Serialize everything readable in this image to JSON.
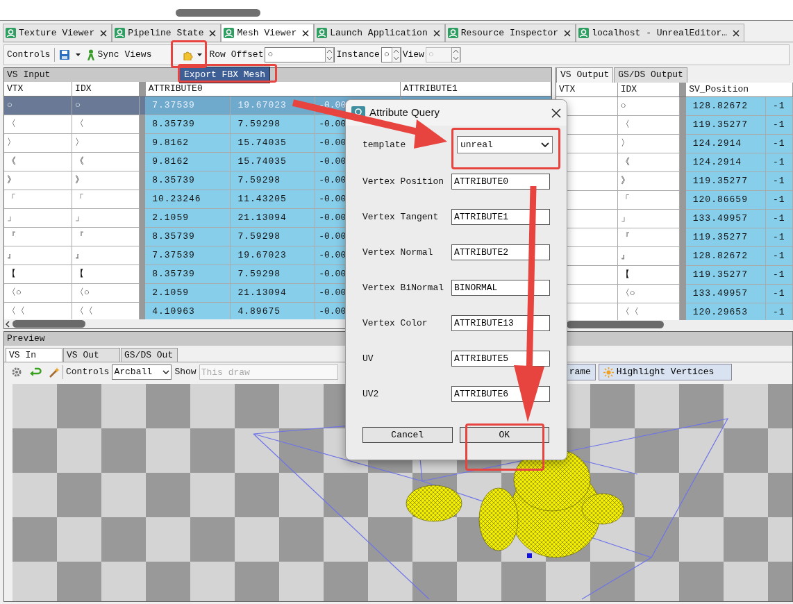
{
  "top_tabs": [
    {
      "label": "Texture Viewer",
      "selected": false
    },
    {
      "label": "Pipeline State",
      "selected": false
    },
    {
      "label": "Mesh Viewer",
      "selected": true
    },
    {
      "label": "Launch Application",
      "selected": false
    },
    {
      "label": "Resource Inspector",
      "selected": false
    },
    {
      "label": "localhost - UnrealEditor…",
      "selected": false
    }
  ],
  "toolbar": {
    "controls_label": "Controls",
    "sync_label": "Sync Views",
    "row_offset_label": "Row Offset",
    "row_offset_value": "○",
    "instance_label": "Instance",
    "instance_value": "○",
    "view_label": "View",
    "view_value": "○",
    "view_disabled": true
  },
  "export_menu": {
    "items": [
      {
        "label": "Export FBX Mesh",
        "selected": true
      }
    ]
  },
  "vs_input": {
    "title": "VS Input",
    "columns": [
      "VTX",
      "IDX",
      "ATTRIBUTE0",
      "ATTRIBUTE1"
    ],
    "rows": [
      {
        "vtx": "○",
        "idx": "○",
        "values": [
          "7.37539",
          "19.67023",
          "-0.00"
        ],
        "selected": true
      },
      {
        "vtx": "〈",
        "idx": "〈",
        "values": [
          "8.35739",
          "7.59298",
          "-0.00"
        ],
        "selected": false
      },
      {
        "vtx": "〉",
        "idx": "〉",
        "values": [
          "9.8162",
          "15.74035",
          "-0.00"
        ],
        "selected": false
      },
      {
        "vtx": "《",
        "idx": "《",
        "values": [
          "9.8162",
          "15.74035",
          "-0.00"
        ],
        "selected": false
      },
      {
        "vtx": "》",
        "idx": "》",
        "values": [
          "8.35739",
          "7.59298",
          "-0.00"
        ],
        "selected": false
      },
      {
        "vtx": "「",
        "idx": "「",
        "values": [
          "10.23246",
          "11.43205",
          "-0.00"
        ],
        "selected": false
      },
      {
        "vtx": "」",
        "idx": "」",
        "values": [
          "2.1059",
          "21.13094",
          "-0.00"
        ],
        "selected": false
      },
      {
        "vtx": "『",
        "idx": "『",
        "values": [
          "8.35739",
          "7.59298",
          "-0.00"
        ],
        "selected": false
      },
      {
        "vtx": "』",
        "idx": "』",
        "values": [
          "7.37539",
          "19.67023",
          "-0.00"
        ],
        "selected": false
      },
      {
        "vtx": "【",
        "idx": "【",
        "values": [
          "8.35739",
          "7.59298",
          "-0.00"
        ],
        "selected": false
      },
      {
        "vtx": "〈○",
        "idx": "〈○",
        "values": [
          "2.1059",
          "21.13094",
          "-0.00"
        ],
        "selected": false
      },
      {
        "vtx": "〈〈",
        "idx": "〈〈",
        "values": [
          "4.10963",
          "4.89675",
          "-0.00"
        ],
        "selected": false
      }
    ]
  },
  "vs_output": {
    "tabs": [
      {
        "label": "VS Output",
        "selected": true
      },
      {
        "label": "GS/DS Output",
        "selected": false
      }
    ],
    "columns": [
      "VTX",
      "IDX",
      "SV_Position"
    ],
    "rows": [
      {
        "idx": "○",
        "values": [
          "128.82672",
          "-1"
        ]
      },
      {
        "idx": "〈",
        "values": [
          "119.35277",
          "-1"
        ]
      },
      {
        "idx": "〉",
        "values": [
          "124.2914",
          "-1"
        ]
      },
      {
        "idx": "《",
        "values": [
          "124.2914",
          "-1"
        ]
      },
      {
        "idx": "》",
        "values": [
          "119.35277",
          "-1"
        ]
      },
      {
        "idx": "「",
        "values": [
          "120.86659",
          "-1"
        ]
      },
      {
        "idx": "」",
        "values": [
          "133.49957",
          "-1"
        ]
      },
      {
        "idx": "『",
        "values": [
          "119.35277",
          "-1"
        ]
      },
      {
        "idx": "』",
        "values": [
          "128.82672",
          "-1"
        ]
      },
      {
        "idx": "【",
        "values": [
          "119.35277",
          "-1"
        ]
      },
      {
        "idx": "〈○",
        "values": [
          "133.49957",
          "-1"
        ]
      },
      {
        "idx": "〈〈",
        "values": [
          "120.29653",
          "-1"
        ]
      }
    ]
  },
  "preview": {
    "title": "Preview",
    "tabs": [
      {
        "label": "VS In",
        "selected": true
      },
      {
        "label": "VS Out",
        "selected": false
      },
      {
        "label": "GS/DS Out",
        "selected": false
      }
    ],
    "controls_label": "Controls",
    "controls_value": "Arcball",
    "show_label": "Show",
    "show_placeholder": "This draw",
    "wireframe_button": "rame",
    "highlight_button": "Highlight Vertices"
  },
  "dialog": {
    "title": "Attribute Query",
    "template_label": "template",
    "template_value": "unreal",
    "fields": [
      {
        "label": "Vertex Position",
        "value": "ATTRIBUTE0"
      },
      {
        "label": "Vertex Tangent",
        "value": "ATTRIBUTE1"
      },
      {
        "label": "Vertex Normal",
        "value": "ATTRIBUTE2"
      },
      {
        "label": "Vertex BiNormal",
        "value": "BINORMAL"
      },
      {
        "label": "Vertex Color",
        "value": "ATTRIBUTE13"
      },
      {
        "label": "UV",
        "value": "ATTRIBUTE5"
      },
      {
        "label": "UV2",
        "value": "ATTRIBUTE6"
      }
    ],
    "buttons": [
      "Cancel",
      "OK"
    ]
  }
}
